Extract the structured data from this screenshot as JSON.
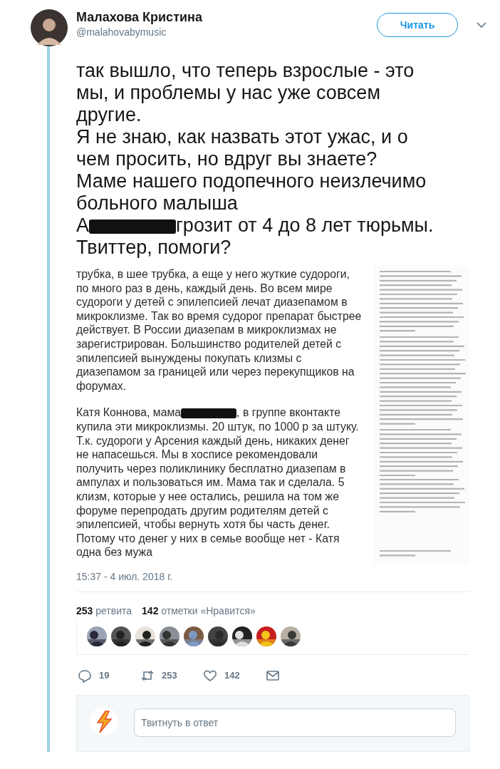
{
  "author": {
    "name": "Малахова Кристина",
    "handle": "@malahovabymusic"
  },
  "follow_button": "Читать",
  "tweet": {
    "paragraphs": [
      {
        "segments": [
          {
            "kind": "text",
            "text": "так вышло, что теперь взрослые - это мы, и проблемы у нас уже совсем другие."
          }
        ]
      },
      {
        "segments": [
          {
            "kind": "text",
            "text": "Я не знаю, как назвать этот ужас, и о чем просить, но вдруг вы знаете?"
          }
        ]
      },
      {
        "segments": [
          {
            "kind": "text",
            "text": "Маме нашего подопечного неизлечимо больного малыша"
          },
          {
            "kind": "short",
            "text": "А"
          },
          {
            "kind": "redacted"
          },
          {
            "kind": "short",
            "text": "грозит от 4 до 8 лет тюрьмы."
          }
        ]
      },
      {
        "segments": [
          {
            "kind": "text",
            "text": "Твиттер, помоги?"
          }
        ]
      }
    ]
  },
  "attachment": {
    "left_paragraphs": [
      {
        "segments": [
          {
            "kind": "text",
            "text": "трубка, в шее трубка, а еще у него жуткие судороги, по много раз в день, каждый день. Во всем мире судороги у детей с эпилепсией лечат диазепамом в микроклизме. Так во время судорог препарат быстрее действует. В России диазепам в микроклизмах не зарегистрирован. Большинство родителей детей с эпилепсией вынуждены покупать клизмы с диазепамом за границей или через перекупщиков на форумах."
          }
        ]
      },
      {
        "segments": [
          {
            "kind": "short",
            "text": "Катя Коннова, мама"
          },
          {
            "kind": "redacted"
          },
          {
            "kind": "short",
            "text": ", в группе вконтакте"
          },
          {
            "kind": "text",
            "text": "купила эти микроклизмы. 20 штук, по 1000 р за штуку. Т.к. судороги у Арсения каждый день, никаких денег не напасешься. Мы в хосписе рекомендовали получить через поликлинику бесплатно диазепам в ампулах и пользоваться им. Мама так и сделала. 5 клизм, которые у нее остались, решила на том же форуме перепродать другим родителям детей с эпилепсией, чтобы вернуть хотя бы часть денег. Потому что денег у них в семье вообще нет - Катя одна без мужа"
          }
        ]
      }
    ]
  },
  "timestamp": "15:37 - 4 июл. 2018 г.",
  "stats": [
    {
      "count": "253",
      "label": "ретвита"
    },
    {
      "count": "142",
      "label": "отметки «Нравится»"
    }
  ],
  "actions": [
    {
      "kind": "reply",
      "count": "19"
    },
    {
      "kind": "retweet",
      "count": "253"
    },
    {
      "kind": "like",
      "count": "142"
    },
    {
      "kind": "message"
    }
  ],
  "reply_box": {
    "placeholder": "Твитнуть в ответ"
  }
}
